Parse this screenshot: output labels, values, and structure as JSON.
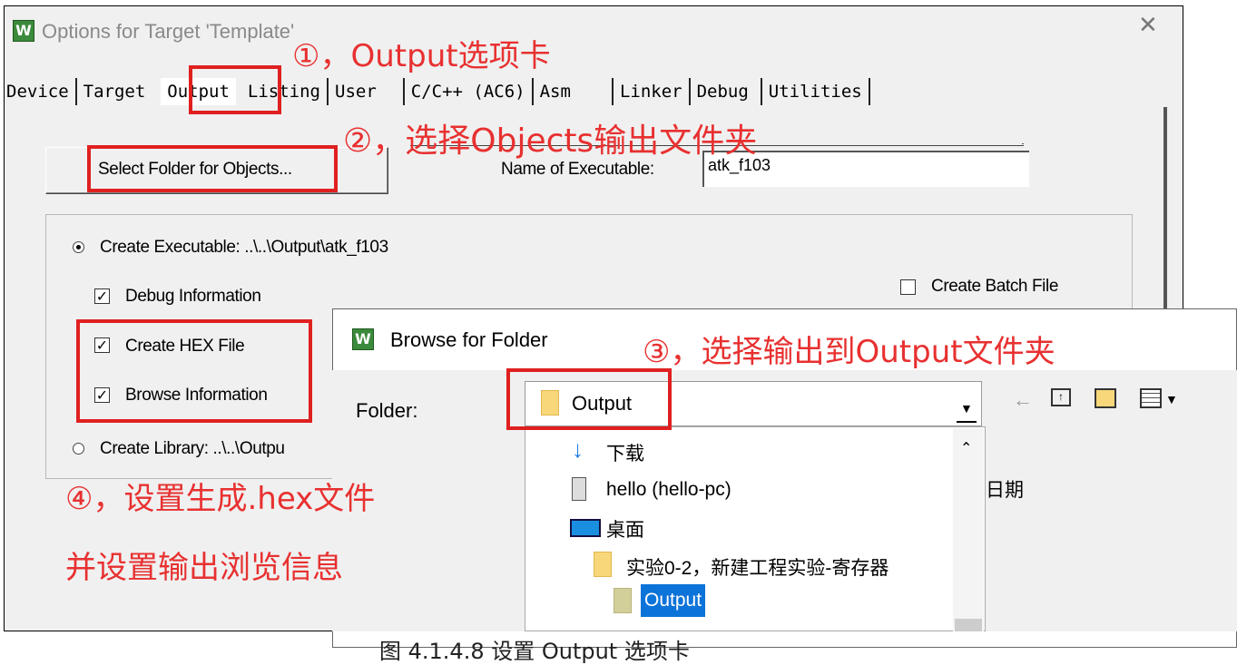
{
  "dialog": {
    "title": "Options for Target 'Template'",
    "close_label": "✕",
    "app_icon_glyph": "W"
  },
  "tabs": [
    "Device",
    "Target",
    "Output",
    "Listing",
    "User",
    "C/C++ (AC6)",
    "Asm",
    "Linker",
    "Debug",
    "Utilities"
  ],
  "active_tab": "Output",
  "output_tab": {
    "select_folder_label": "Select Folder for Objects...",
    "name_label": "Name of Executable:",
    "name_value": "atk_f103",
    "create_executable_label": "Create Executable:  ..\\..\\Output\\atk_f103",
    "debug_info_label": "Debug Information",
    "create_batch_label": "Create Batch File",
    "create_hex_label": "Create HEX File",
    "browse_info_label": "Browse Information",
    "create_library_label": "Create Library:  ..\\..\\Outpu",
    "checks": {
      "debug_info": true,
      "create_batch": false,
      "create_hex": true,
      "browse_info": true
    }
  },
  "browse_dialog": {
    "title": "Browse for Folder",
    "folder_label": "Folder:",
    "folder_value": "Output",
    "column_date": "日期",
    "tree_items": [
      {
        "label": "下载",
        "icon": "download-arrow-icon"
      },
      {
        "label": "hello (hello-pc)",
        "icon": "computer-icon"
      },
      {
        "label": "桌面",
        "icon": "desktop-icon"
      },
      {
        "label": "实验0-2，新建工程实验-寄存器",
        "icon": "folder-icon"
      },
      {
        "label": "Output",
        "icon": "folder-icon",
        "selected": true
      }
    ]
  },
  "annotations": {
    "a1": "①，Output选项卡",
    "a2": "②，选择Objects输出文件夹",
    "a3": "③，选择输出到Output文件夹",
    "a4_line1": "④，设置生成.hex文件",
    "a4_line2": "并设置输出浏览信息"
  },
  "footer_caption": "图 4.1.4.8 设置 Output 选项卡",
  "colors": {
    "annotation_red": "#e83030",
    "selection_blue": "#0c73d9",
    "folder_yellow": "#f7d77a"
  }
}
